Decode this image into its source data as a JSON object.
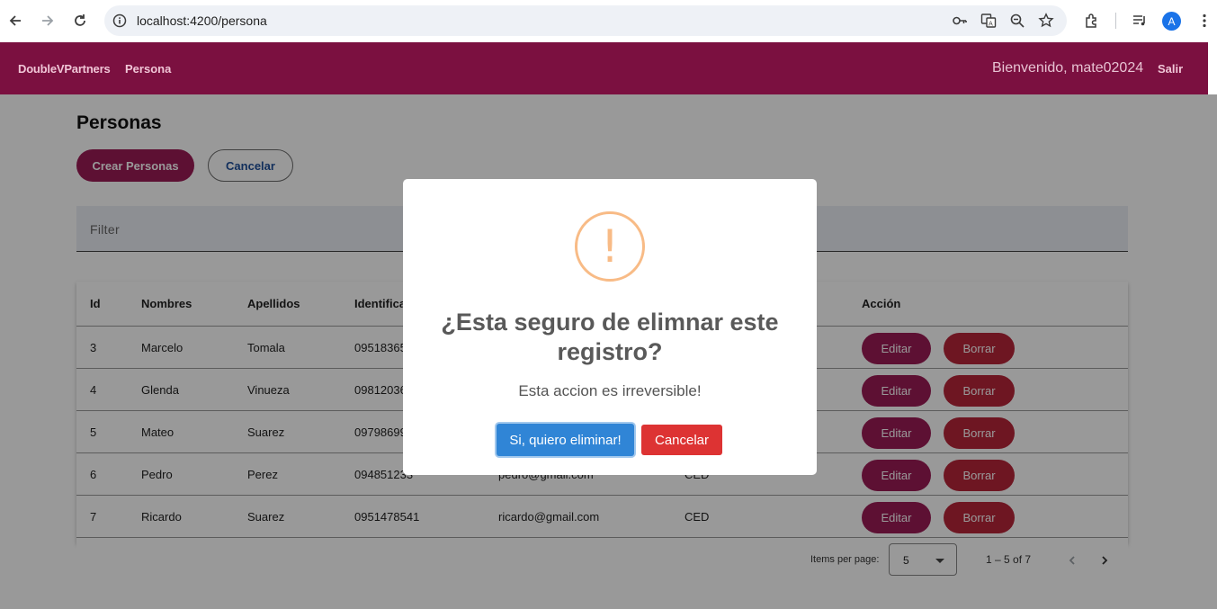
{
  "browser": {
    "url": "localhost:4200/persona",
    "avatar_letter": "A"
  },
  "header": {
    "brand": "DoubleVPartners",
    "nav_persona": "Persona",
    "welcome": "Bienvenido, mate02024",
    "logout": "Salir"
  },
  "page": {
    "title": "Personas",
    "create_button": "Crear Personas",
    "cancel_button": "Cancelar",
    "filter_placeholder": "Filter"
  },
  "table": {
    "headers": {
      "id": "Id",
      "nombres": "Nombres",
      "apellidos": "Apellidos",
      "identificacion": "Identifica",
      "accion": "Acción"
    },
    "rows": [
      {
        "id": "3",
        "nombres": "Marcelo",
        "apellidos": "Tomala",
        "identificacion": "09518365",
        "email": "",
        "tipo": ""
      },
      {
        "id": "4",
        "nombres": "Glenda",
        "apellidos": "Vinueza",
        "identificacion": "09812036",
        "email": "",
        "tipo": ""
      },
      {
        "id": "5",
        "nombres": "Mateo",
        "apellidos": "Suarez",
        "identificacion": "09798699",
        "email": "",
        "tipo": ""
      },
      {
        "id": "6",
        "nombres": "Pedro",
        "apellidos": "Perez",
        "identificacion": "094851233",
        "email": "pedro@gmail.com",
        "tipo": "CED"
      },
      {
        "id": "7",
        "nombres": "Ricardo",
        "apellidos": "Suarez",
        "identificacion": "0951478541",
        "email": "ricardo@gmail.com",
        "tipo": "CED"
      }
    ],
    "edit_label": "Editar",
    "delete_label": "Borrar"
  },
  "paginator": {
    "items_per_page_label": "Items per page:",
    "page_size": "5",
    "range": "1 – 5 of 7"
  },
  "dialog": {
    "icon": "!",
    "title": "¿Esta seguro de elimnar este registro?",
    "text": "Esta accion es irreversible!",
    "confirm_label": "Si, quiero eliminar!",
    "cancel_label": "Cancelar"
  },
  "colors": {
    "header_bg": "#7b1040",
    "primary_button": "#9c1c55",
    "delete_button": "#b8263a",
    "confirm_button": "#3085d6",
    "deny_button": "#dd3333",
    "warning_icon": "#f8bb86"
  }
}
